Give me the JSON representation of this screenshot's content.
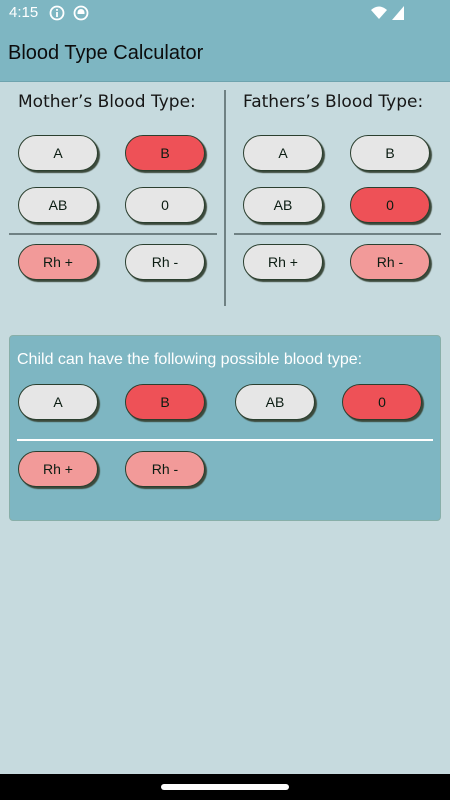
{
  "status_bar": {
    "time": "4:15",
    "icons": [
      "info-icon",
      "shield-icon",
      "wifi-icon",
      "cell-signal-icon"
    ]
  },
  "app": {
    "title": "Blood Type Calculator"
  },
  "mother": {
    "label": "Mother’s Blood Type:",
    "types": [
      {
        "label": "A",
        "selected": false
      },
      {
        "label": "B",
        "selected": true
      },
      {
        "label": "AB",
        "selected": false
      },
      {
        "label": "0",
        "selected": false
      }
    ],
    "rh": [
      {
        "label": "Rh +",
        "selected": true
      },
      {
        "label": "Rh -",
        "selected": false
      }
    ]
  },
  "father": {
    "label": "Fathers’s Blood Type:",
    "types": [
      {
        "label": "A",
        "selected": false
      },
      {
        "label": "B",
        "selected": false
      },
      {
        "label": "AB",
        "selected": false
      },
      {
        "label": "0",
        "selected": true
      }
    ],
    "rh": [
      {
        "label": "Rh +",
        "selected": false
      },
      {
        "label": "Rh -",
        "selected": true
      }
    ]
  },
  "result": {
    "label": "Child can have the following possible blood type:",
    "types": [
      {
        "label": "A",
        "selected": false
      },
      {
        "label": "B",
        "selected": true
      },
      {
        "label": "AB",
        "selected": false
      },
      {
        "label": "0",
        "selected": true
      }
    ],
    "rh": [
      {
        "label": "Rh +",
        "selected": true
      },
      {
        "label": "Rh -",
        "selected": true
      }
    ]
  },
  "colors": {
    "accent": "#7eb6c2",
    "background": "#c6dade",
    "selected_type": "#ee5157",
    "selected_rh": "#f29a99",
    "unselected": "#e6e6e6"
  }
}
